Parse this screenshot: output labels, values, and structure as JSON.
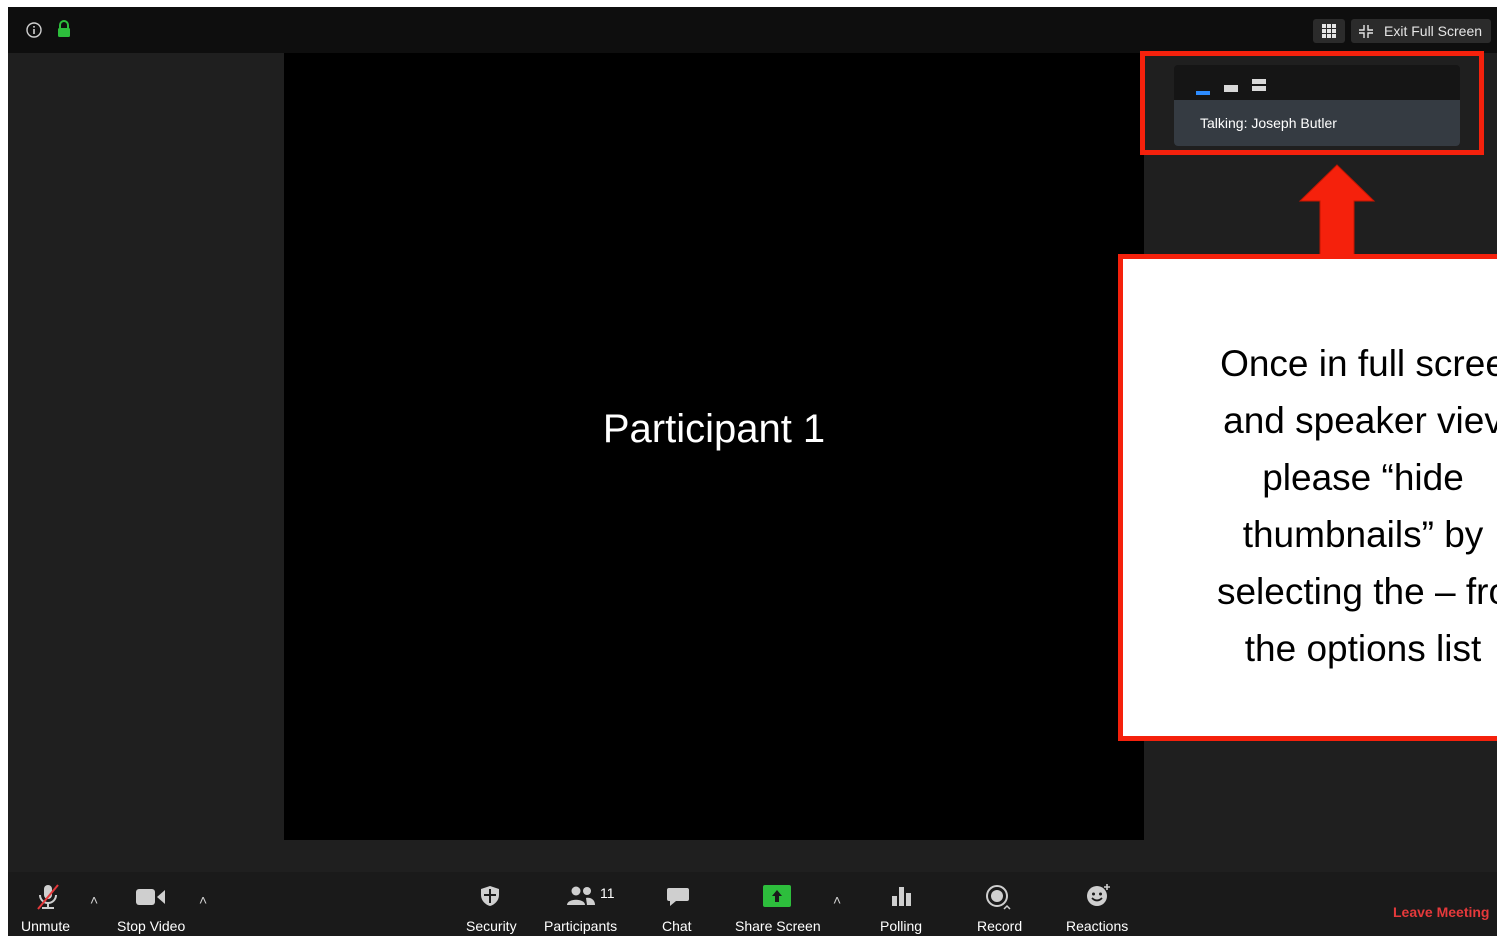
{
  "topbar": {
    "exit_full_screen": "Exit Full Screen"
  },
  "video": {
    "participant_name": "Participant 1"
  },
  "talk_panel": {
    "talking": "Talking: Joseph Butler"
  },
  "callout": {
    "lines": [
      "Once in full scree",
      "and speaker viev",
      "please “hide",
      "thumbnails” by",
      "selecting the – fro",
      "the options list"
    ]
  },
  "toolbar": {
    "unmute": "Unmute",
    "stop_video": "Stop Video",
    "security": "Security",
    "participants": "Participants",
    "participant_count": "11",
    "chat": "Chat",
    "share_screen": "Share Screen",
    "polling": "Polling",
    "record": "Record",
    "reactions": "Reactions",
    "leave_meeting": "Leave Meeting"
  },
  "colors": {
    "accent_red": "#f5210c",
    "share_green": "#2dbe3c",
    "leave_red": "#e5393b",
    "lock_green": "#2dbe3c",
    "thumb_blue": "#2d8cff"
  }
}
